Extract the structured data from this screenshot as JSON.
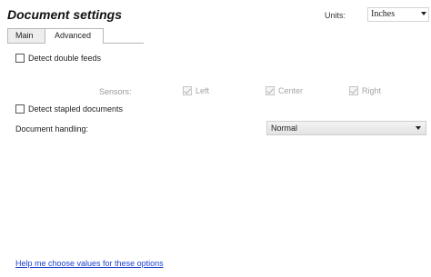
{
  "header": {
    "title": "Document settings",
    "units_label": "Units:",
    "units_value": "Inches"
  },
  "tabs": [
    {
      "label": "Main",
      "active": false
    },
    {
      "label": "Advanced",
      "active": true
    }
  ],
  "options": {
    "detect_double_feeds": {
      "label": "Detect double feeds",
      "checked": false
    },
    "sensors_label": "Sensors:",
    "sensors": [
      {
        "label": "Left",
        "checked": true,
        "enabled": false
      },
      {
        "label": "Center",
        "checked": true,
        "enabled": false
      },
      {
        "label": "Right",
        "checked": true,
        "enabled": false
      }
    ],
    "detect_stapled": {
      "label": "Detect stapled documents",
      "checked": false
    },
    "document_handling_label": "Document handling:",
    "document_handling_value": "Normal"
  },
  "footer": {
    "help_link": "Help me choose values for these options"
  },
  "colors": {
    "link": "#1a3fd0",
    "disabled_text": "#a5a5a5"
  }
}
